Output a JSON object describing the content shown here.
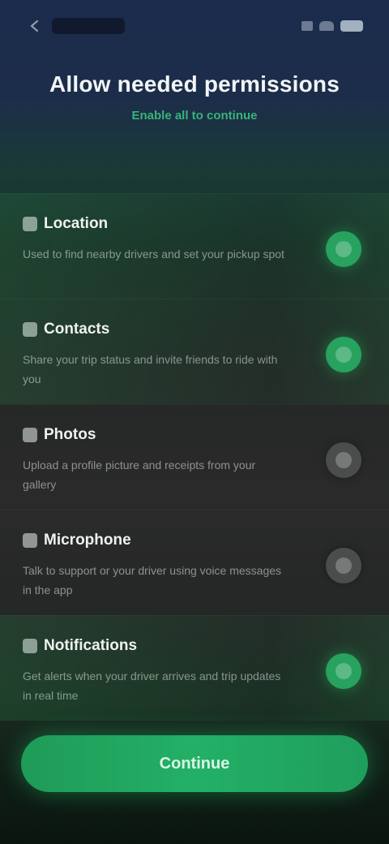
{
  "header": {
    "title": "Allow needed permissions",
    "subtitle": "Enable all to continue"
  },
  "permissions": [
    {
      "title": "Location",
      "description": "Used to find nearby drivers and set your pickup spot",
      "state": "on",
      "icon": "location-icon"
    },
    {
      "title": "Contacts",
      "description": "Share your trip status and invite friends to ride with you",
      "state": "on",
      "icon": "contacts-icon"
    },
    {
      "title": "Photos",
      "description": "Upload a profile picture and receipts from your gallery",
      "state": "off",
      "icon": "photo-icon"
    },
    {
      "title": "Microphone",
      "description": "Talk to support or your driver using voice messages in the app",
      "state": "off",
      "icon": "microphone-icon"
    },
    {
      "title": "Notifications",
      "description": "Get alerts when your driver arrives and trip updates in real time",
      "state": "on",
      "icon": "bell-icon"
    }
  ],
  "cta": {
    "label": "Continue"
  },
  "colors": {
    "accent": "#27a25f",
    "background_top": "#1b2b4c",
    "toggle_off": "#4a4d4c"
  }
}
